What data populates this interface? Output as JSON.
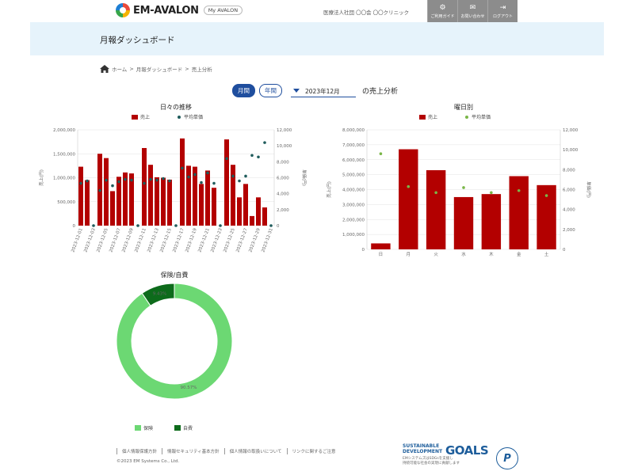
{
  "header": {
    "brand": "EM-AVALON",
    "my_label": "My AVALON",
    "clinic_name": "医療法人社団 〇〇会 〇〇クリニック",
    "buttons": [
      {
        "icon": "⚙",
        "label": "ご利用ガイド"
      },
      {
        "icon": "✉",
        "label": "お問い合わせ"
      },
      {
        "icon": "⇥",
        "label": "ログアウト"
      }
    ]
  },
  "page": {
    "title": "月報ダッシュボード"
  },
  "breadcrumb": {
    "home": "ホーム",
    "sep": ">",
    "dashboard": "月報ダッシュボード",
    "current": "売上分析"
  },
  "controls": {
    "monthly": "月間",
    "yearly": "年間",
    "month_value": "2023年12月",
    "suffix": "の売上分析"
  },
  "colors": {
    "bar": "#b30000",
    "dot_daily": "#1f5c5c",
    "dot_weekday": "#7ab648",
    "pie_main": "#6cd873",
    "pie_other": "#0d6b1b",
    "accent": "#1f4e9e"
  },
  "chart_data": [
    {
      "type": "bar",
      "title": "日々の推移",
      "legend": [
        "売上",
        "平均単価"
      ],
      "ylabel_left": "売上(円)",
      "ylabel_right": "単価(円)",
      "ylim_left": [
        0,
        2000000
      ],
      "ylim_right": [
        0,
        12000
      ],
      "yticks_left": [
        "0",
        "500,000",
        "1,000,000",
        "1,500,000",
        "2,000,000"
      ],
      "yticks_right": [
        "0",
        "2,000",
        "4,000",
        "6,000",
        "8,000",
        "10,000",
        "12,000"
      ],
      "categories": [
        "2023-12-01",
        "2023-12-02",
        "2023-12-03",
        "2023-12-04",
        "2023-12-05",
        "2023-12-06",
        "2023-12-07",
        "2023-12-08",
        "2023-12-09",
        "2023-12-10",
        "2023-12-11",
        "2023-12-12",
        "2023-12-13",
        "2023-12-14",
        "2023-12-15",
        "2023-12-16",
        "2023-12-17",
        "2023-12-18",
        "2023-12-19",
        "2023-12-20",
        "2023-12-21",
        "2023-12-22",
        "2023-12-23",
        "2023-12-24",
        "2023-12-25",
        "2023-12-26",
        "2023-12-27",
        "2023-12-28",
        "2023-12-29",
        "2023-12-30",
        "2023-12-31"
      ],
      "xtick_labels": [
        "2023-12-01",
        "2023-12-03",
        "2023-12-05",
        "2023-12-07",
        "2023-12-09",
        "2023-12-11",
        "2023-12-13",
        "2023-12-15",
        "2023-12-17",
        "2023-12-19",
        "2023-12-21",
        "2023-12-23",
        "2023-12-25",
        "2023-12-27",
        "2023-12-29",
        "2023-12-31"
      ],
      "series": [
        {
          "name": "売上",
          "values": [
            1230000,
            950000,
            0,
            1500000,
            1410000,
            720000,
            1020000,
            1110000,
            1090000,
            0,
            1620000,
            1270000,
            1010000,
            1000000,
            960000,
            0,
            1820000,
            1250000,
            1230000,
            870000,
            1150000,
            790000,
            0,
            1800000,
            1270000,
            590000,
            870000,
            200000,
            590000,
            380000,
            0
          ]
        },
        {
          "name": "平均単価",
          "values": [
            5300,
            5600,
            0,
            4400,
            5700,
            5000,
            5500,
            5800,
            5700,
            0,
            5300,
            5800,
            5700,
            5900,
            5600,
            0,
            7200,
            6100,
            6400,
            5400,
            6600,
            5300,
            0,
            8400,
            6200,
            5600,
            6200,
            8800,
            8600,
            10400,
            0
          ]
        }
      ]
    },
    {
      "type": "bar",
      "title": "曜日別",
      "legend": [
        "売上",
        "平均単価"
      ],
      "ylabel_left": "売上(円)",
      "ylabel_right": "単価(円)",
      "ylim_left": [
        0,
        8000000
      ],
      "ylim_right": [
        0,
        12000
      ],
      "yticks_left": [
        "0",
        "1,000,000",
        "2,000,000",
        "3,000,000",
        "4,000,000",
        "5,000,000",
        "6,000,000",
        "7,000,000",
        "8,000,000"
      ],
      "yticks_right": [
        "0",
        "2,000",
        "4,000",
        "6,000",
        "8,000",
        "10,000",
        "12,000"
      ],
      "categories": [
        "日",
        "月",
        "火",
        "水",
        "木",
        "金",
        "土"
      ],
      "series": [
        {
          "name": "売上",
          "values": [
            400000,
            6700000,
            5300000,
            3500000,
            3700000,
            4900000,
            4300000
          ]
        },
        {
          "name": "平均単価",
          "values": [
            9600,
            6300,
            5700,
            6200,
            5700,
            5900,
            5400
          ]
        }
      ]
    },
    {
      "type": "pie",
      "title": "保険/自費",
      "legend": [
        "保険",
        "自費"
      ],
      "series": [
        {
          "name": "保険",
          "values": [
            90.57
          ]
        },
        {
          "name": "自費",
          "values": [
            9.43
          ]
        }
      ],
      "labels": [
        "90.57%",
        "9.43%"
      ]
    }
  ],
  "footer": {
    "links": [
      "個人情報保護方針",
      "情報セキュリティ基本方針",
      "個人情報の取扱いについて",
      "リンクに関するご注意"
    ],
    "copyright": "©2023 EM Systems Co., Ltd.",
    "sdg_title1": "SUSTAINABLE",
    "sdg_title2": "DEVELOPMENT",
    "sdg_goals": "GOALS",
    "sdg_sub1": "EMシステムズはSDGsを支援し",
    "sdg_sub2": "持続可能な社会の実現に貢献します",
    "pmark": "P"
  }
}
